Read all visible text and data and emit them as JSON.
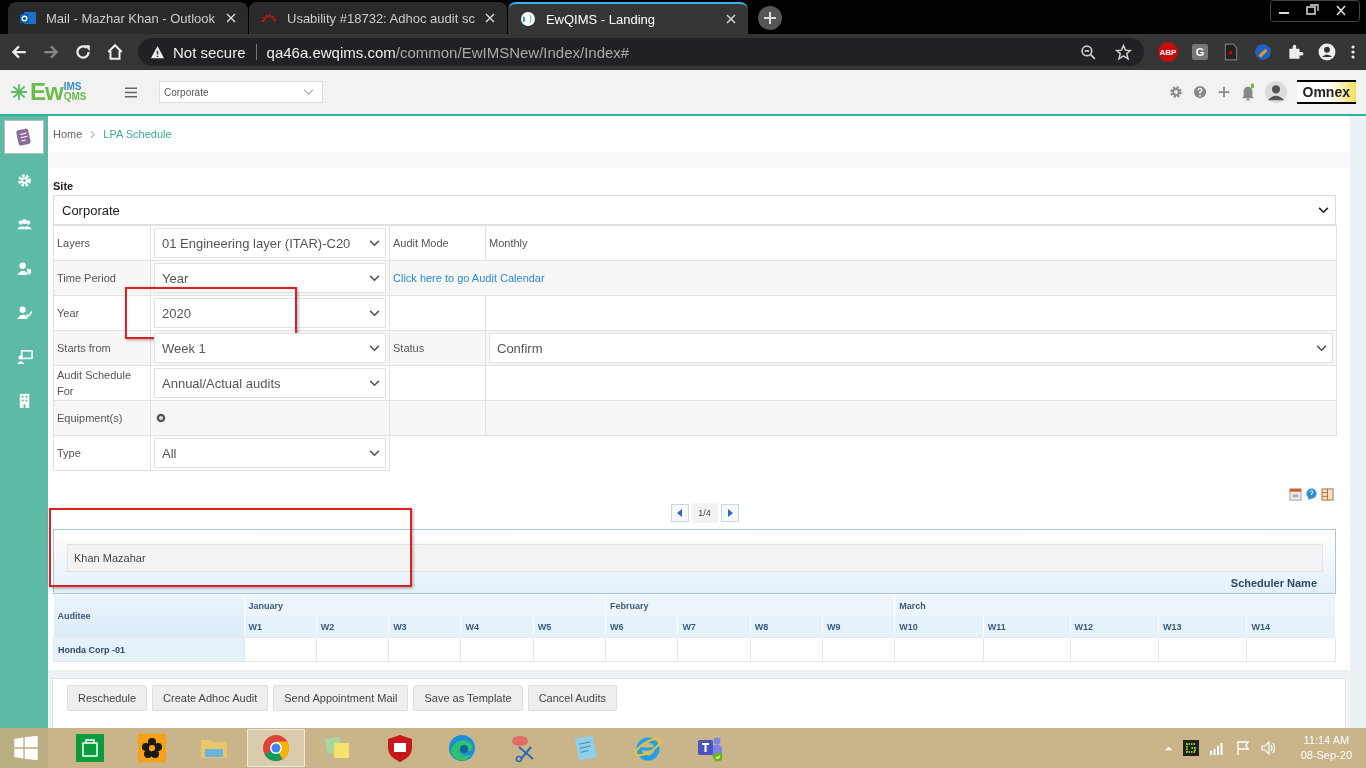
{
  "browser": {
    "tabs": [
      {
        "title": "Mail - Mazhar Khan - Outlook",
        "kind": "outlook",
        "selected": false
      },
      {
        "title": "Usability #18732: Adhoc audit sc",
        "kind": "arc",
        "selected": false
      },
      {
        "title": "EwQIMS - Landing",
        "kind": "site",
        "selected": true
      }
    ],
    "security": "Not secure",
    "host": "qa46a.ewqims.com",
    "path": "/common/EwIMSNew/Index/Index#",
    "extensions": [
      {
        "kind": "abp",
        "label": "ABP"
      },
      {
        "kind": "g",
        "label": "G"
      },
      {
        "kind": "doc"
      },
      {
        "kind": "brush"
      }
    ]
  },
  "header": {
    "logo": {
      "main": "Ew",
      "top": "IMS",
      "bottom": "QMS"
    },
    "site_select": "Corporate",
    "brand": "Omnex"
  },
  "sidebar": [
    {
      "kind": "doc",
      "selected": true
    },
    {
      "kind": "gear",
      "selected": false
    },
    {
      "kind": "group",
      "selected": false
    },
    {
      "kind": "user-shield",
      "selected": false
    },
    {
      "kind": "user-check",
      "selected": false
    },
    {
      "kind": "board",
      "selected": false
    },
    {
      "kind": "building",
      "selected": false
    }
  ],
  "breadcrumb": [
    "Home",
    "LPA Schedule"
  ],
  "site": {
    "label": "Site",
    "value": "Corporate"
  },
  "form_rows": [
    {
      "cells": [
        {
          "kind": "label",
          "text": "Layers"
        },
        {
          "kind": "select",
          "value": "01 Engineering layer (ITAR)-C20",
          "highlighted": false
        },
        {
          "kind": "label",
          "text": "Audit Mode"
        },
        {
          "kind": "text",
          "text": "Monthly"
        }
      ]
    },
    {
      "cells": [
        {
          "kind": "label",
          "text": "Time Period"
        },
        {
          "kind": "select",
          "value": "Year",
          "highlighted": false
        },
        {
          "kind": "link",
          "text": "Click here to go Audit Calendar"
        }
      ]
    },
    {
      "cells": [
        {
          "kind": "label",
          "text": "Year"
        },
        {
          "kind": "select",
          "value": "2020",
          "highlighted": true
        },
        {
          "kind": "empty"
        },
        {
          "kind": "empty"
        }
      ]
    },
    {
      "cells": [
        {
          "kind": "label",
          "text": "Starts from"
        },
        {
          "kind": "select",
          "value": "Week 1",
          "highlighted": false
        },
        {
          "kind": "label",
          "text": "Status"
        },
        {
          "kind": "select",
          "value": "Confirm",
          "highlighted": false
        }
      ]
    },
    {
      "cells": [
        {
          "kind": "label",
          "text": "Audit Schedule For"
        },
        {
          "kind": "select",
          "value": "Annual/Actual audits",
          "highlighted": false
        },
        {
          "kind": "empty"
        },
        {
          "kind": "empty"
        }
      ]
    },
    {
      "cells": [
        {
          "kind": "label",
          "text": "Equipment(s)"
        },
        {
          "kind": "radio"
        },
        {
          "kind": "empty"
        },
        {
          "kind": "empty"
        }
      ]
    },
    {
      "cells": [
        {
          "kind": "label",
          "text": "Type"
        },
        {
          "kind": "select",
          "value": "All",
          "highlighted": false
        }
      ]
    }
  ],
  "pager": {
    "page": "1/4"
  },
  "scheduler": {
    "name": "Khan Mazahar",
    "label": "Scheduler Name",
    "highlighted": true
  },
  "calendar": {
    "auditee_header": "Auditee",
    "months": [
      {
        "name": "January",
        "weeks": [
          "W1",
          "W2",
          "W3",
          "W4",
          "W5"
        ]
      },
      {
        "name": "February",
        "weeks": [
          "W6",
          "W7",
          "W8",
          "W9"
        ]
      },
      {
        "name": "March",
        "weeks": [
          "W10",
          "W11",
          "W12",
          "W13",
          "W14"
        ]
      }
    ],
    "rows": [
      {
        "auditee": "Honda Corp -01"
      }
    ]
  },
  "actions": [
    "Reschedule",
    "Create Adhoc Audit",
    "Send Appointment Mail",
    "Save as Template",
    "Cancel Audits"
  ],
  "taskbar": {
    "apps": [
      {
        "kind": "store",
        "active": false
      },
      {
        "kind": "flower",
        "active": false
      },
      {
        "kind": "folder",
        "active": false
      },
      {
        "kind": "chrome",
        "active": true
      },
      {
        "kind": "notes",
        "active": false
      },
      {
        "kind": "shield",
        "active": false
      },
      {
        "kind": "edge",
        "active": false
      },
      {
        "kind": "scissors",
        "active": false
      },
      {
        "kind": "notepad",
        "active": false
      },
      {
        "kind": "ie",
        "active": false
      },
      {
        "kind": "teams",
        "active": false
      }
    ],
    "time": "11:14 AM",
    "date": "08-Sep-20"
  }
}
